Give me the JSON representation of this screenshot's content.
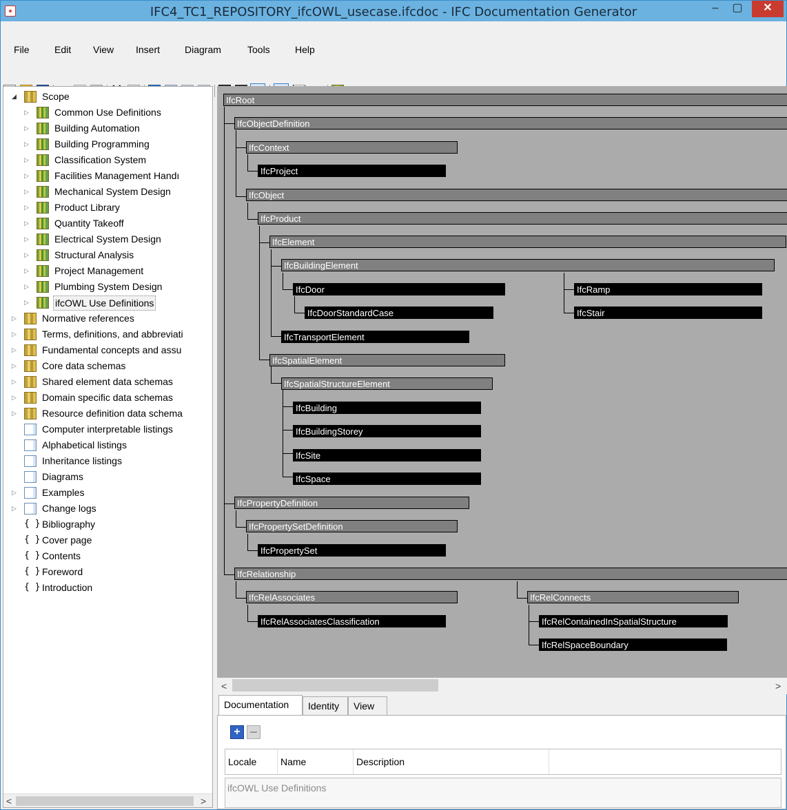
{
  "window": {
    "title": "IFC4_TC1_REPOSITORY_ifcOWL_usecase.ifcdoc - IFC Documentation Generator",
    "min_label": "–",
    "max_label": "▢",
    "close_label": "✕"
  },
  "menu": [
    "File",
    "Edit",
    "View",
    "Insert",
    "Diagram",
    "Tools",
    "Help"
  ],
  "tree": {
    "scope": "Scope",
    "scope_children": [
      "Common Use Definitions",
      "Building Automation",
      "Building Programming",
      "Classification System",
      "Facilities Management Handı",
      "Mechanical System Design",
      "Product Library",
      "Quantity Takeoff",
      "Electrical System Design",
      "Structural Analysis",
      "Project Management",
      "Plumbing System Design",
      "ifcOWL Use Definitions"
    ],
    "sections": [
      "Normative references",
      "Terms, definitions, and abbreviati",
      "Fundamental concepts and assu",
      "Core data schemas",
      "Shared element data schemas",
      "Domain specific data schemas",
      "Resource definition data schema"
    ],
    "pages": [
      "Computer interpretable listings",
      "Alphabetical listings",
      "Inheritance listings",
      "Diagrams",
      "Examples",
      "Change logs"
    ],
    "braces": [
      "Bibliography",
      "Cover page",
      "Contents",
      "Foreword",
      "Introduction"
    ],
    "brace_glyph": "{ }"
  },
  "diagram": {
    "nodes": {
      "root": "IfcRoot",
      "objdef": "IfcObjectDefinition",
      "context": "IfcContext",
      "project": "IfcProject",
      "object": "IfcObject",
      "product": "IfcProduct",
      "element": "IfcElement",
      "bldgelem": "IfcBuildingElement",
      "door": "IfcDoor",
      "doorstd": "IfcDoorStandardCase",
      "ramp": "IfcRamp",
      "stair": "IfcStair",
      "transport": "IfcTransportElement",
      "spatial": "IfcSpatialElement",
      "spatialstruct": "IfcSpatialStructureElement",
      "building": "IfcBuilding",
      "storey": "IfcBuildingStorey",
      "site": "IfcSite",
      "space": "IfcSpace",
      "propdef": "IfcPropertyDefinition",
      "propsetdef": "IfcPropertySetDefinition",
      "propset": "IfcPropertySet",
      "rel": "IfcRelationship",
      "relassoc": "IfcRelAssociates",
      "relassoccls": "IfcRelAssociatesClassification",
      "relconn": "IfcRelConnects",
      "relcontained": "IfcRelContainedInSpatialStructure",
      "relspace": "IfcRelSpaceBoundary"
    }
  },
  "tabs": [
    "Documentation",
    "Identity",
    "View"
  ],
  "grid": {
    "columns": [
      "Locale",
      "Name",
      "Description"
    ],
    "doc_text": "ifcOWL Use Definitions"
  }
}
